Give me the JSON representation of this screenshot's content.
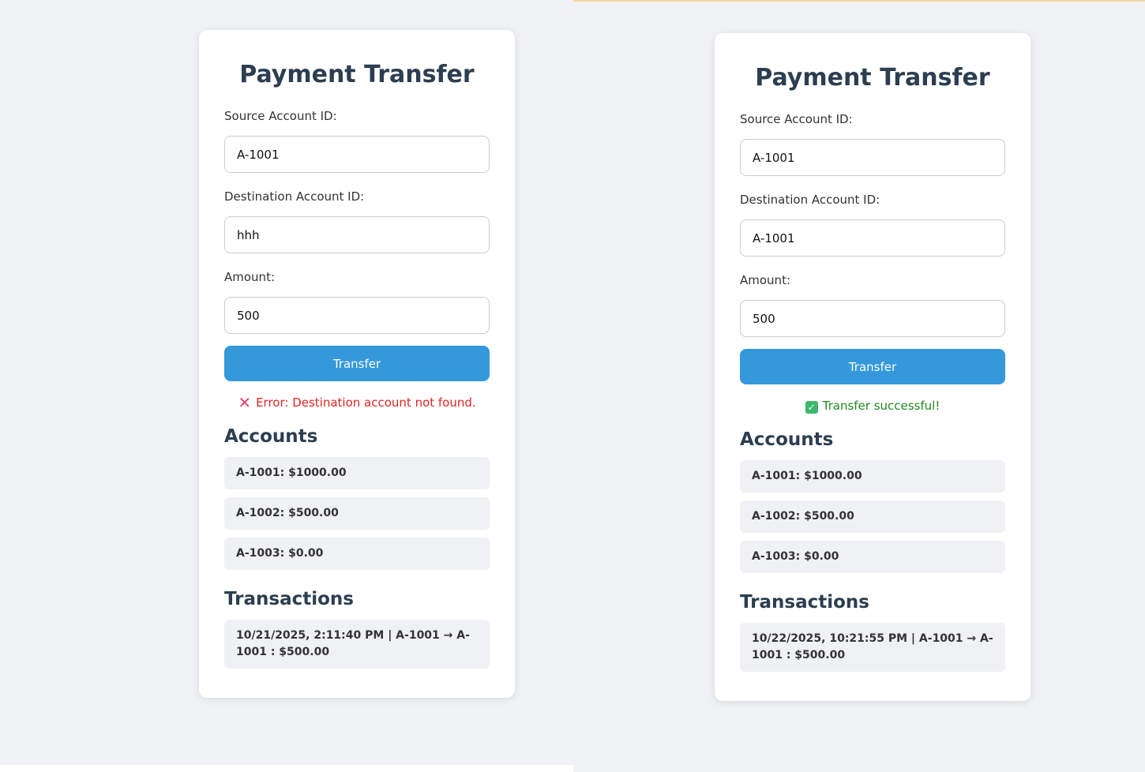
{
  "panels": [
    {
      "title": "Payment Transfer",
      "source_label": "Source Account ID:",
      "source_value": "A-1001",
      "destination_label": "Destination Account ID:",
      "destination_value": "hhh",
      "amount_label": "Amount:",
      "amount_value": "500",
      "transfer_button": "Transfer",
      "message": {
        "type": "error",
        "icon": "cross-mark-icon",
        "text": "Error: Destination account not found."
      },
      "accounts_heading": "Accounts",
      "accounts": [
        "A-1001: $1000.00",
        "A-1002: $500.00",
        "A-1003: $0.00"
      ],
      "transactions_heading": "Transactions",
      "transactions": [
        "10/21/2025, 2:11:40 PM | A-1001 → A-1001 : $500.00"
      ]
    },
    {
      "title": "Payment Transfer",
      "source_label": "Source Account ID:",
      "source_value": "A-1001",
      "destination_label": "Destination Account ID:",
      "destination_value": "A-1001",
      "amount_label": "Amount:",
      "amount_value": "500",
      "transfer_button": "Transfer",
      "message": {
        "type": "success",
        "icon": "check-mark-icon",
        "text": "Transfer successful!"
      },
      "accounts_heading": "Accounts",
      "accounts": [
        "A-1001: $1000.00",
        "A-1002: $500.00",
        "A-1003: $0.00"
      ],
      "transactions_heading": "Transactions",
      "transactions": [
        "10/22/2025, 10:21:55 PM | A-1001 → A-1001 : $500.00"
      ]
    }
  ],
  "colors": {
    "background": "#f0f2f5",
    "accent": "#3498db",
    "heading": "#2c3e50",
    "error": "#e02424",
    "success": "#1f8a1f"
  }
}
